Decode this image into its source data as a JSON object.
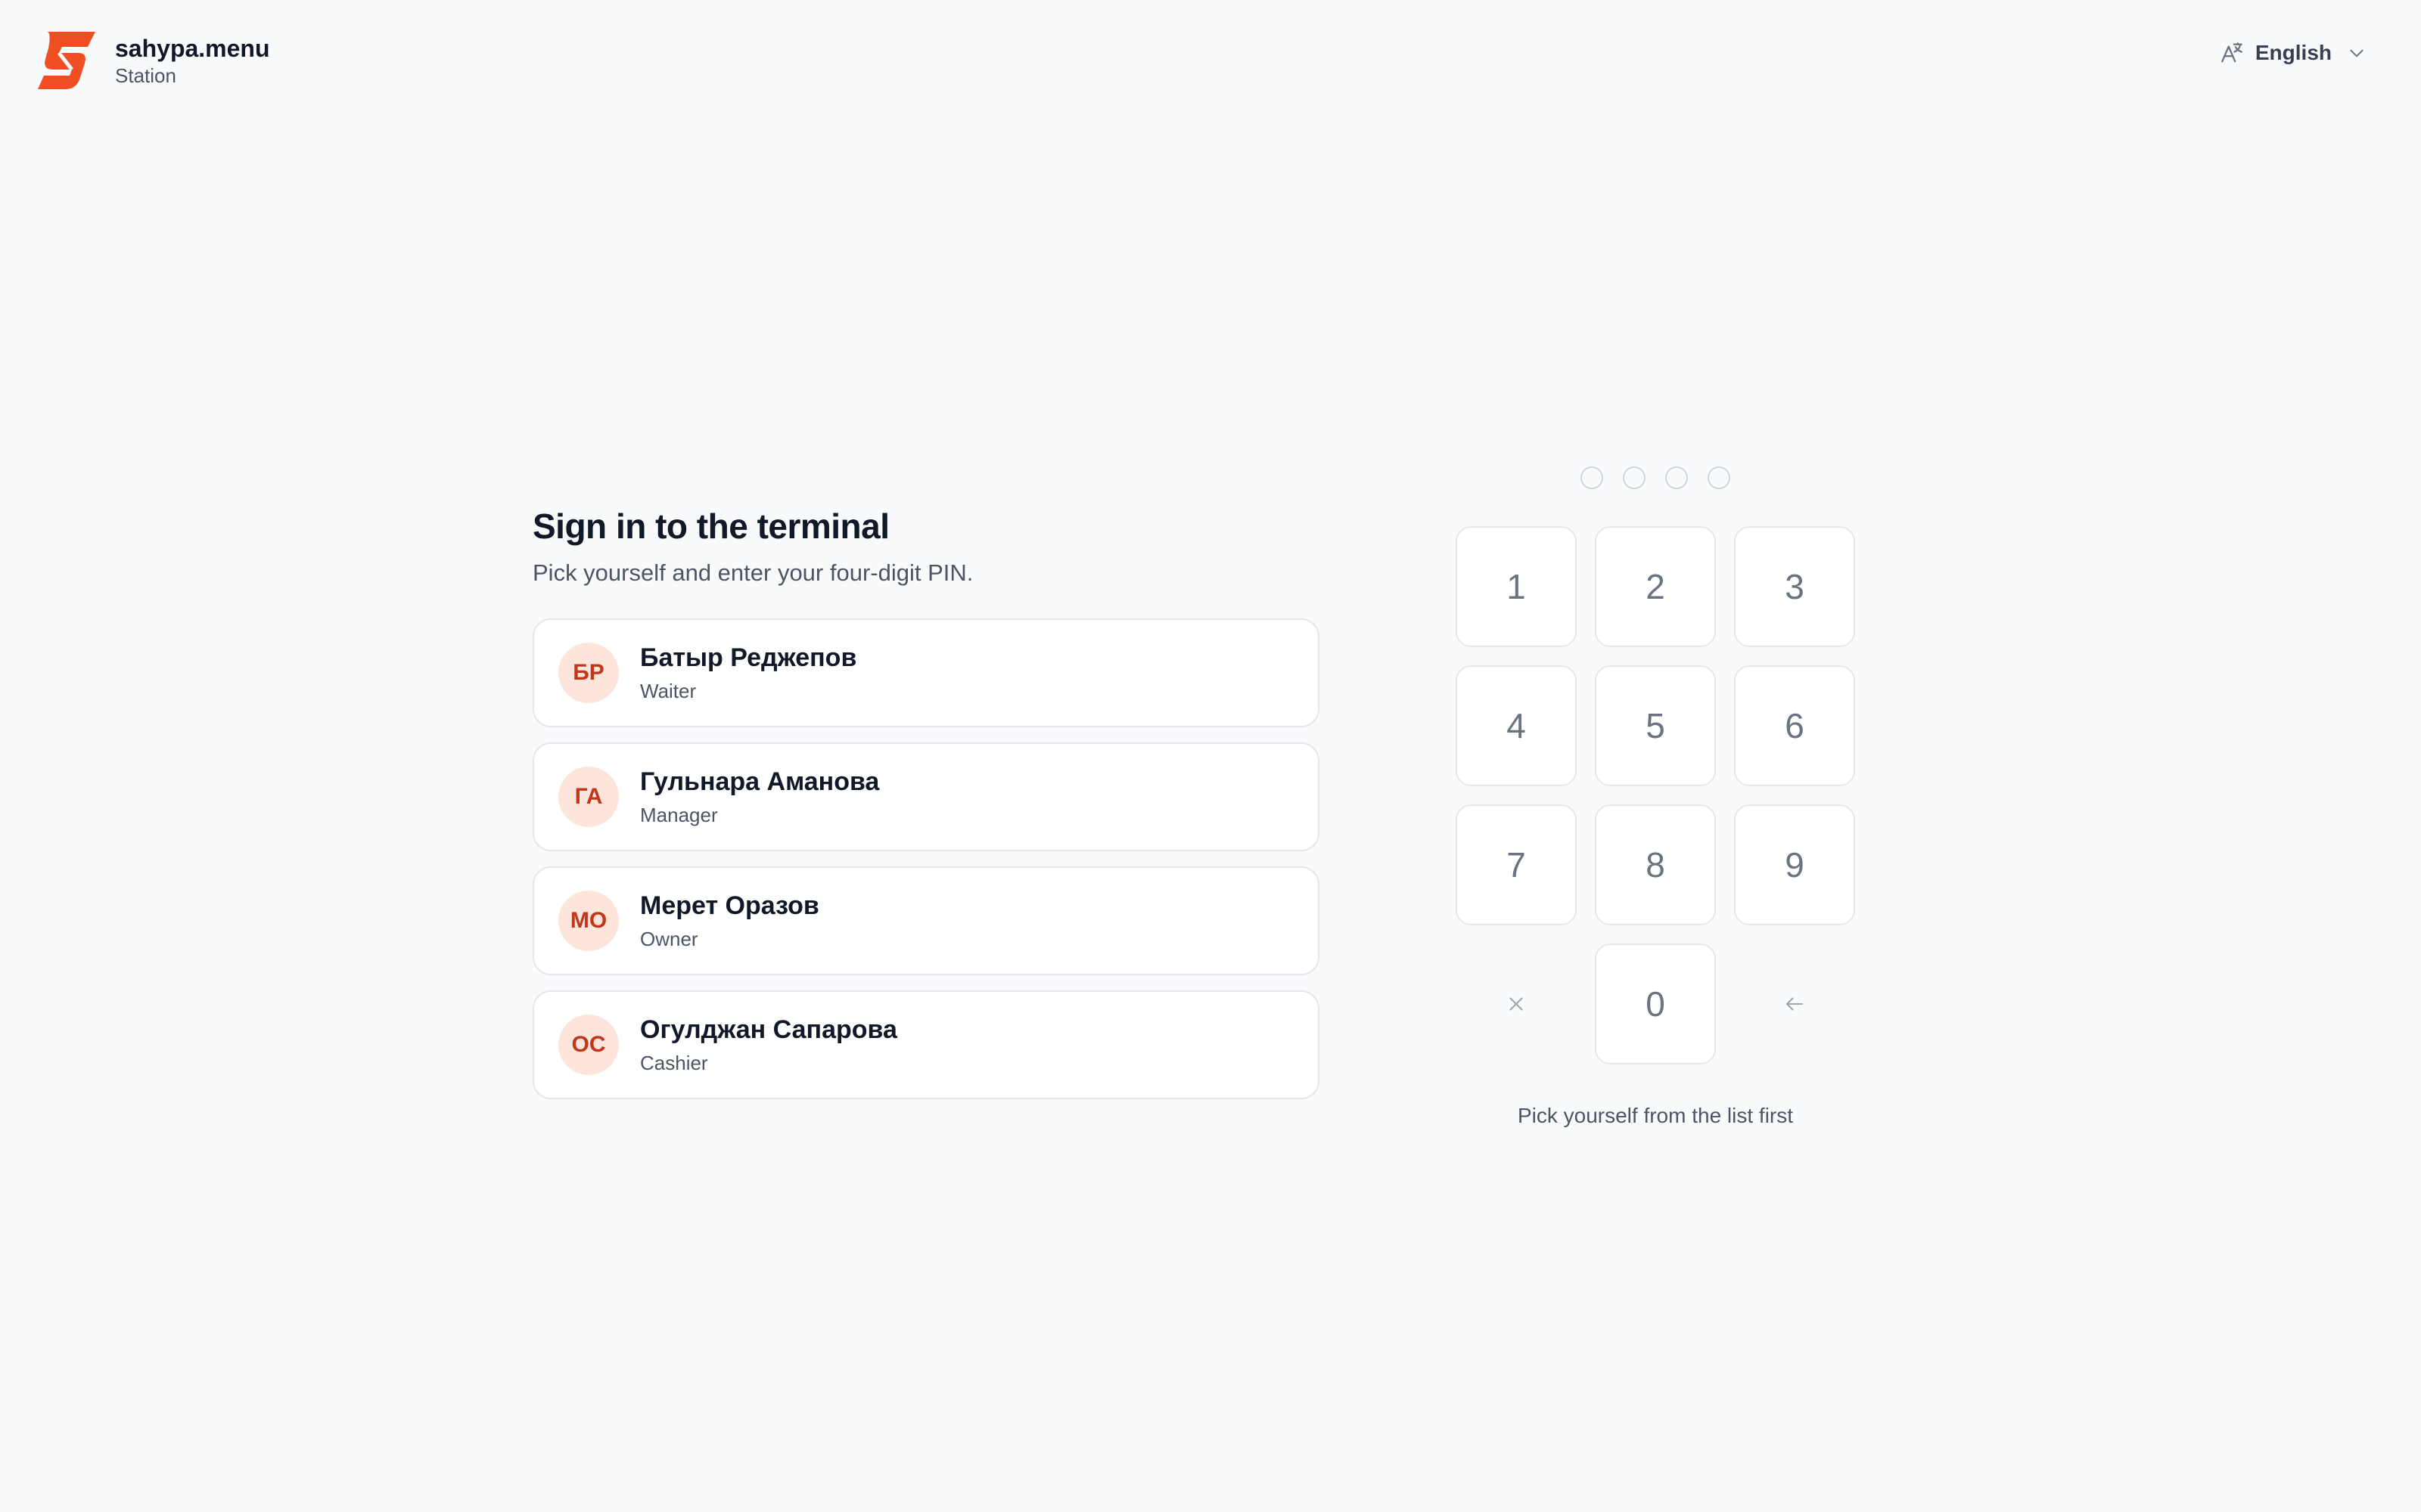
{
  "brand": {
    "name": "sahypa.menu",
    "subtitle": "Station",
    "logo_icon": "sahypa-s-logo-icon",
    "accent": "#ef4f23"
  },
  "language": {
    "label": "English",
    "icon": "translate-icon"
  },
  "signin": {
    "title": "Sign in to the terminal",
    "subtitle": "Pick yourself and enter your four-digit PIN.",
    "staff": [
      {
        "initials": "БР",
        "name": "Батыр Реджепов",
        "role": "Waiter"
      },
      {
        "initials": "ГА",
        "name": "Гульнара Аманова",
        "role": "Manager"
      },
      {
        "initials": "МО",
        "name": "Мерет Оразов",
        "role": "Owner"
      },
      {
        "initials": "ОС",
        "name": "Огулджан Сапарова",
        "role": "Cashier"
      }
    ]
  },
  "pinpad": {
    "digits_entered": 0,
    "pin_length": 4,
    "keys": [
      "1",
      "2",
      "3",
      "4",
      "5",
      "6",
      "7",
      "8",
      "9",
      "0"
    ],
    "clear_icon": "close-icon",
    "backspace_icon": "arrow-left-icon",
    "hint": "Pick yourself from the list first"
  }
}
